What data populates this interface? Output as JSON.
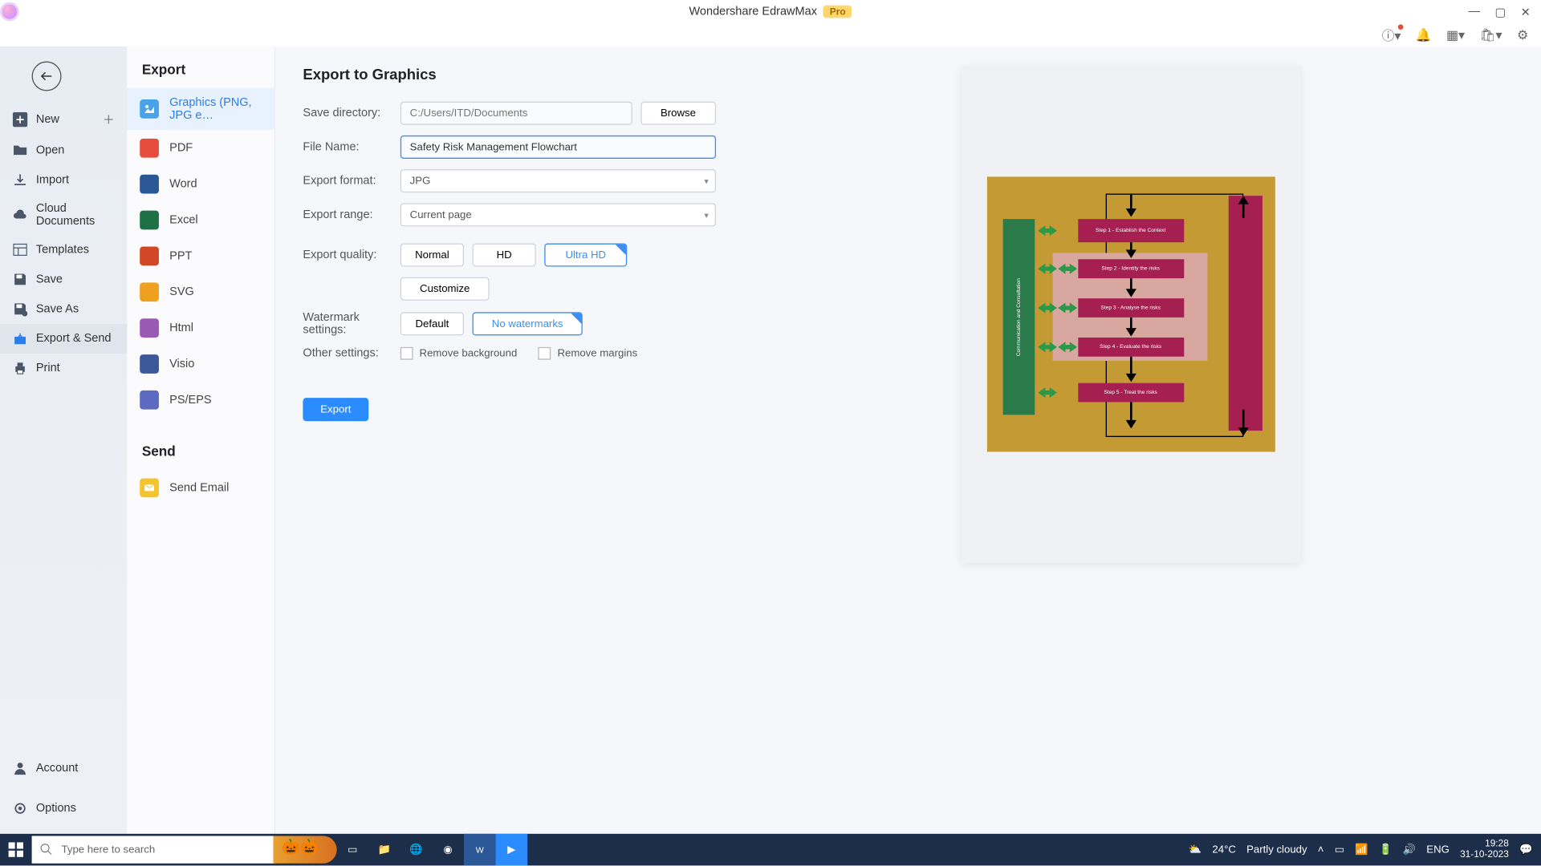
{
  "titlebar": {
    "title": "Wondershare EdrawMax",
    "pro": "Pro"
  },
  "rail": {
    "new": "New",
    "open": "Open",
    "import": "Import",
    "cloud": "Cloud Documents",
    "templates": "Templates",
    "save": "Save",
    "saveas": "Save As",
    "exportsend": "Export & Send",
    "print": "Print",
    "account": "Account",
    "options": "Options"
  },
  "export": {
    "heading": "Export",
    "items": {
      "graphics": "Graphics (PNG, JPG e…",
      "pdf": "PDF",
      "word": "Word",
      "excel": "Excel",
      "ppt": "PPT",
      "svg": "SVG",
      "html": "Html",
      "visio": "Visio",
      "pseps": "PS/EPS"
    },
    "send_heading": "Send",
    "send_email": "Send Email"
  },
  "form": {
    "title": "Export to Graphics",
    "labels": {
      "dir": "Save directory:",
      "name": "File Name:",
      "format": "Export format:",
      "range": "Export range:",
      "quality": "Export quality:",
      "watermark": "Watermark settings:",
      "other": "Other settings:"
    },
    "dir_value": "C:/Users/ITD/Documents",
    "browse": "Browse",
    "name_value": "Safety Risk Management Flowchart",
    "format_value": "JPG",
    "range_value": "Current page",
    "quality": {
      "normal": "Normal",
      "hd": "HD",
      "ultra": "Ultra HD",
      "customize": "Customize"
    },
    "watermark": {
      "default": "Default",
      "none": "No watermarks"
    },
    "other": {
      "bg": "Remove background",
      "margins": "Remove margins"
    },
    "export_btn": "Export"
  },
  "preview": {
    "leftbar": "Communication and Consultation",
    "steps": {
      "s1": "Step 1 - Establish the Context",
      "s2": "Step 2 - Identify the risks",
      "s3": "Step 3 - Analyse the risks",
      "s4": "Step 4 - Evaluate the risks",
      "s5": "Step 5 - Treat the risks"
    }
  },
  "taskbar": {
    "search_placeholder": "Type here to search",
    "weather_temp": "24°C",
    "weather_text": "Partly cloudy",
    "lang": "ENG",
    "time": "19:28",
    "date": "31-10-2023"
  }
}
